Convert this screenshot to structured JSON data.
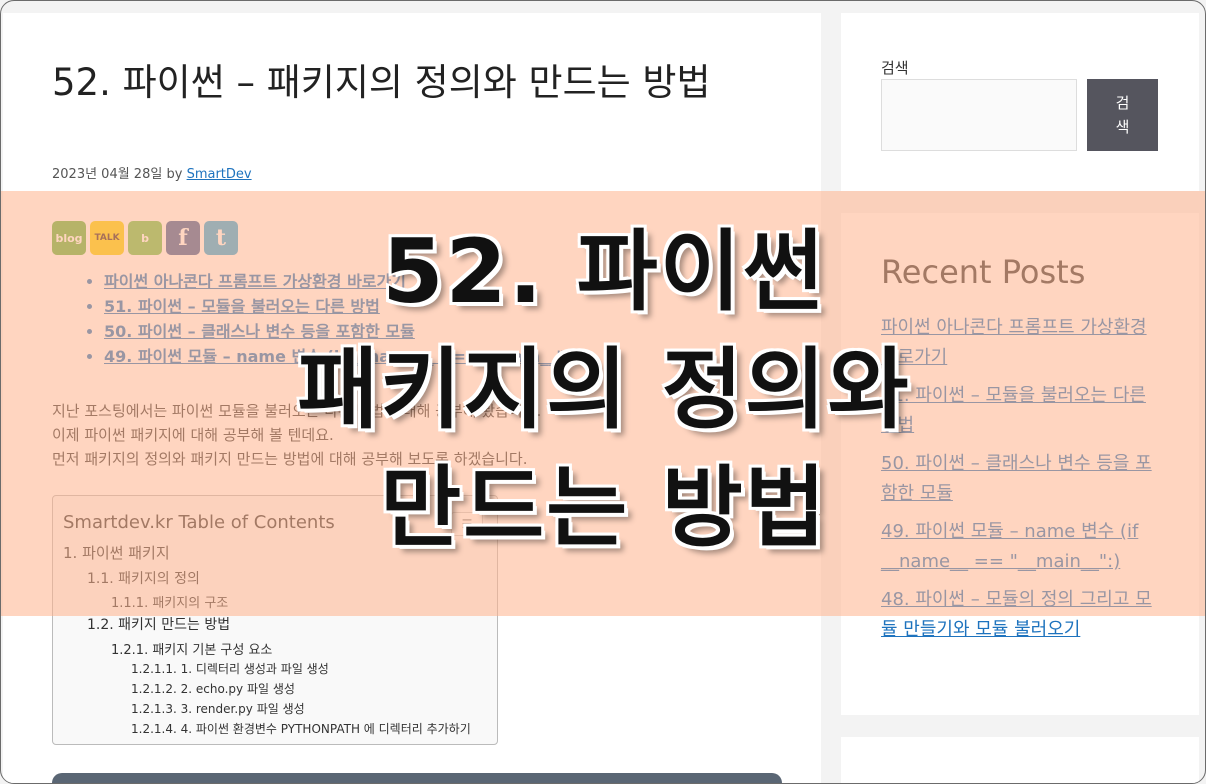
{
  "post": {
    "title": "52. 파이썬 – 패키지의 정의와 만드는 방법",
    "date": "2023년 04월 28일",
    "by": "by",
    "author": "SmartDev"
  },
  "share": {
    "blog": "blog",
    "kakao": "TALK",
    "band": "b",
    "facebook": "f",
    "twitter": "t"
  },
  "related_posts": [
    "파이썬 아나콘다 프롬프트 가상환경 바로가기",
    "51. 파이썬 – 모듈을 불러오는 다른 방법",
    "50. 파이썬 – 클래스나 변수 등을 포함한 모듈",
    "49. 파이썬 모듈 – name 변수 (if __name__ == \"__main__\":)"
  ],
  "body": {
    "p1": "지난 포스팅에서는 파이썬 모듈을 불러오는 다른 방법에 대해 공부해 봤습니다.",
    "p2": "이제 파이썬 패키지에 대해 공부해 볼 텐데요.",
    "p3": "먼저 패키지의 정의와 패키지 만드는 방법에 대해 공부해 보도록 하겠습니다."
  },
  "toc": {
    "title": "Smartdev.kr Table of Contents",
    "toggle": "☰",
    "items": [
      "1. 파이썬 패키지",
      "1.1. 패키지의 정의",
      "1.1.1. 패키지의 구조",
      "1.2. 패키지 만드는 방법",
      "1.2.1. 패키지 기본 구성 요소",
      "1.2.1.1. 1. 디렉터리 생성과 파일 생성",
      "1.2.1.2. 2. echo.py 파일 생성",
      "1.2.1.3. 3. render.py 파일 생성",
      "1.2.1.4. 4. 파이썬 환경변수 PYTHONPATH 에 디렉터리 추가하기"
    ]
  },
  "sidebar": {
    "search_label": "검색",
    "search_value": "",
    "search_button": "검색",
    "recent_heading": "Recent Posts",
    "recent_posts": [
      "파이썬 아나콘다 프롬프트 가상환경 바로가기",
      "51. 파이썬 – 모듈을 불러오는 다른 방법",
      "50. 파이썬 – 클래스나 변수 등을 포함한 모듈",
      "49. 파이썬 모듈 – name 변수 (if __name__ == \"__main__\":)",
      "48. 파이썬 – 모듈의 정의 그리고 모듈 만들기와 모듈 불러오기"
    ]
  },
  "overlay": {
    "line1": "52. 파이썬",
    "line2": "패키지의 정의와",
    "line3": "만드는 방법"
  },
  "colors": {
    "link": "#1e73be",
    "overlay_band": "#ffb28c",
    "search_button": "#55555e"
  }
}
